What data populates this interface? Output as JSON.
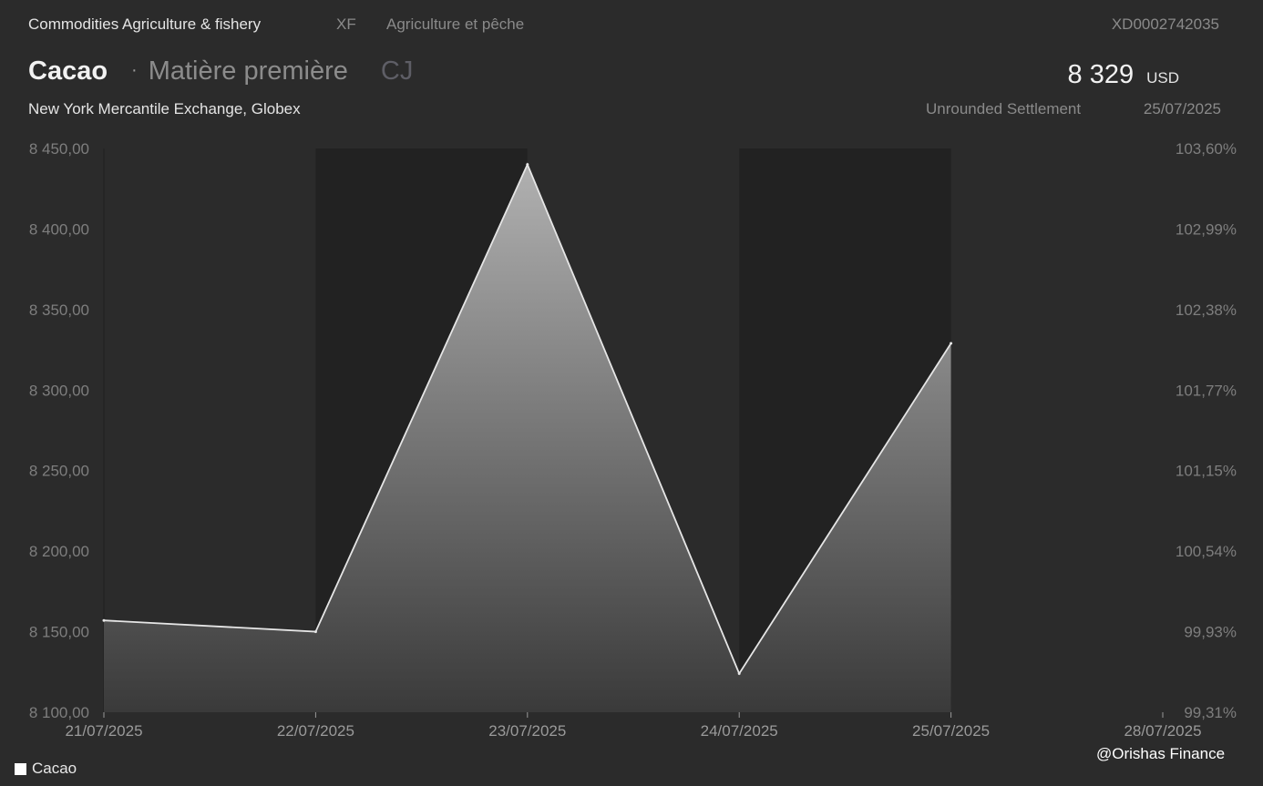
{
  "header": {
    "category": "Commodities Agriculture & fishery",
    "category_code": "XF",
    "category_fr": "Agriculture et pêche",
    "isin": "XD0002742035",
    "title": "Cacao",
    "separator": "·",
    "subtype": "Matière première",
    "ticker": "CJ",
    "exchange": "New York Mercantile Exchange, Globex",
    "price": "8 329",
    "currency": "USD",
    "settlement_label": "Unrounded Settlement",
    "settlement_date": "25/07/2025"
  },
  "legend": {
    "label": "Cacao"
  },
  "watermark": "@Orishas Finance",
  "colors": {
    "background": "#2b2b2b",
    "band": "#222222",
    "line": "#e6e6e6",
    "fill_top": "#b4b4b4",
    "fill_bottom": "#3a3a3a"
  },
  "chart_data": {
    "type": "area",
    "categories": [
      "21/07/2025",
      "22/07/2025",
      "23/07/2025",
      "24/07/2025",
      "25/07/2025",
      "28/07/2025"
    ],
    "series": [
      {
        "name": "Cacao",
        "values": [
          8157,
          8150,
          8440,
          8124,
          8329
        ]
      }
    ],
    "ylim": [
      8100,
      8450
    ],
    "y_ticks": [
      "8 100,00",
      "8 150,00",
      "8 200,00",
      "8 250,00",
      "8 300,00",
      "8 350,00",
      "8 400,00",
      "8 450,00"
    ],
    "y2_ticks": [
      "99,31%",
      "99,93%",
      "100,54%",
      "101,15%",
      "101,77%",
      "102,38%",
      "102,99%",
      "103,60%"
    ],
    "shaded_bands": [
      [
        "22/07/2025",
        "23/07/2025"
      ],
      [
        "24/07/2025",
        "25/07/2025"
      ]
    ],
    "grid": false,
    "legend_position": "bottom-left"
  }
}
